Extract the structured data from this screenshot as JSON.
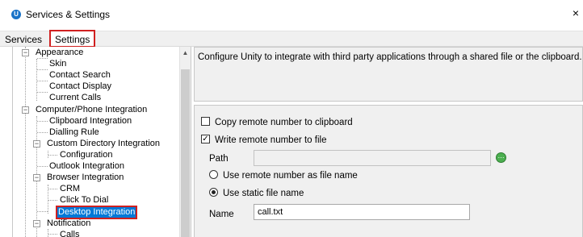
{
  "window": {
    "title": "Services & Settings",
    "close_label": "×",
    "app_icon_letter": "U"
  },
  "tabs": {
    "services": "Services",
    "settings": "Settings"
  },
  "tree": {
    "appearance": "Appearance",
    "skin": "Skin",
    "contact_search": "Contact Search",
    "contact_display": "Contact Display",
    "current_calls": "Current Calls",
    "computer_phone_integration": "Computer/Phone Integration",
    "clipboard_integration": "Clipboard Integration",
    "dialling_rule": "Dialling Rule",
    "custom_directory_integration": "Custom Directory Integration",
    "configuration": "Configuration",
    "outlook_integration": "Outlook Integration",
    "browser_integration": "Browser Integration",
    "crm": "CRM",
    "click_to_dial": "Click To Dial",
    "desktop_integration": "Desktop Integration",
    "notification": "Notification",
    "calls": "Calls"
  },
  "description": "Configure Unity to integrate with third party applications through a shared file or the clipboard.",
  "options": {
    "copy_remote_number": {
      "label": "Copy remote number to clipboard",
      "checked": false
    },
    "write_remote_number": {
      "label": "Write remote number to file",
      "checked": true
    },
    "path": {
      "label": "Path",
      "value": ""
    },
    "use_remote_as_file_name": {
      "label": "Use remote number as file name",
      "selected": false
    },
    "use_static_file_name": {
      "label": "Use static file name",
      "selected": true
    },
    "name": {
      "label": "Name",
      "value": "call.txt"
    }
  },
  "colors": {
    "selection": "#0078d7",
    "highlight_box": "#d02020",
    "panel_bg": "#f0f0f0"
  }
}
